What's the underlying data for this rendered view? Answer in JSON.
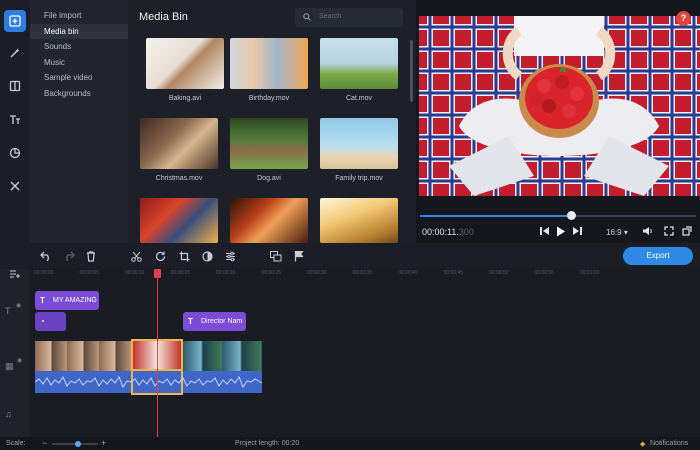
{
  "categories": [
    "File import",
    "Media bin",
    "Sounds",
    "Music",
    "Sample video",
    "Backgrounds"
  ],
  "bin": {
    "title": "Media Bin",
    "search_placeholder": "Search",
    "files": [
      "Baking.avi",
      "Birthday.mov",
      "Cat.mov",
      "Christmas.mov",
      "Dog.avi",
      "Family trip.mov"
    ]
  },
  "preview": {
    "help": "?",
    "time_main": "00:00:11.",
    "time_ms": "300",
    "ratio": "16:9",
    "progress": 0.55
  },
  "toolbar": {
    "export_label": "Export"
  },
  "ruler": [
    "00:00:00",
    "00:00:05",
    "00:00:10",
    "00:00:15",
    "00:00:20",
    "00:00:25",
    "00:00:30",
    "00:00:35",
    "00:00:40",
    "00:00:45",
    "00:00:50",
    "00:00:55",
    "00:01:00"
  ],
  "timeline": {
    "title_clip_1": "MY AMAZING",
    "title_clip_2": "Director Nam"
  },
  "status": {
    "scale_label": "Scale:",
    "project_length": "Project length: 00:20",
    "notifications": "Notifications"
  },
  "icons": [
    "import-icon",
    "magic-wand-icon",
    "transitions-icon",
    "titles-icon",
    "stickers-icon",
    "tools-icon",
    "search-icon",
    "skip-back-icon",
    "play-icon",
    "skip-forward-icon",
    "volume-icon",
    "fullscreen-icon",
    "detach-icon",
    "undo-icon",
    "redo-icon",
    "delete-icon",
    "cut-icon",
    "rotate-icon",
    "crop-icon",
    "color-icon",
    "adjust-icon",
    "overlay-icon",
    "marker-icon",
    "add-track-icon"
  ]
}
